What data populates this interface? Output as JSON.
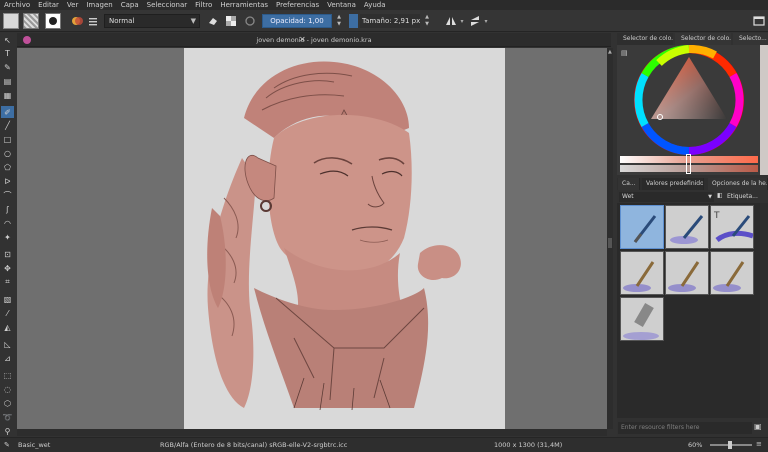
{
  "menu": [
    "Archivo",
    "Editar",
    "Ver",
    "Imagen",
    "Capa",
    "Seleccionar",
    "Filtro",
    "Herramientas",
    "Preferencias",
    "Ventana",
    "Ayuda"
  ],
  "toolbar": {
    "blend_mode": "Normal",
    "opacity_label": "Opacidad: 1,00",
    "size_label": "Tamaño: 2,91 px"
  },
  "document": {
    "tab_title": "joven demonio - joven demonio.kra"
  },
  "dock": {
    "tabs": [
      "Selector de colo...",
      "Selector de colo...",
      "Selecto..."
    ],
    "preset_tabs": [
      "Ca...",
      "Valores predefinidos...",
      "Opciones de la he..."
    ],
    "preset_tag": "Wet",
    "preset_tag_search": "Etiqueta...",
    "filter_placeholder": "Enter resource filters here"
  },
  "status": {
    "preset_name": "Basic_wet",
    "color_space": "RGB/Alfa (Entero de 8 bits/canal)  sRGB-elle-V2-srgbtrc.icc",
    "dimensions": "1000 x 1300 (31,4M)",
    "zoom": "60%"
  },
  "colors": {
    "accent": "#3d6ea3",
    "ui_bg": "#323232",
    "skin": "#c98f85"
  }
}
